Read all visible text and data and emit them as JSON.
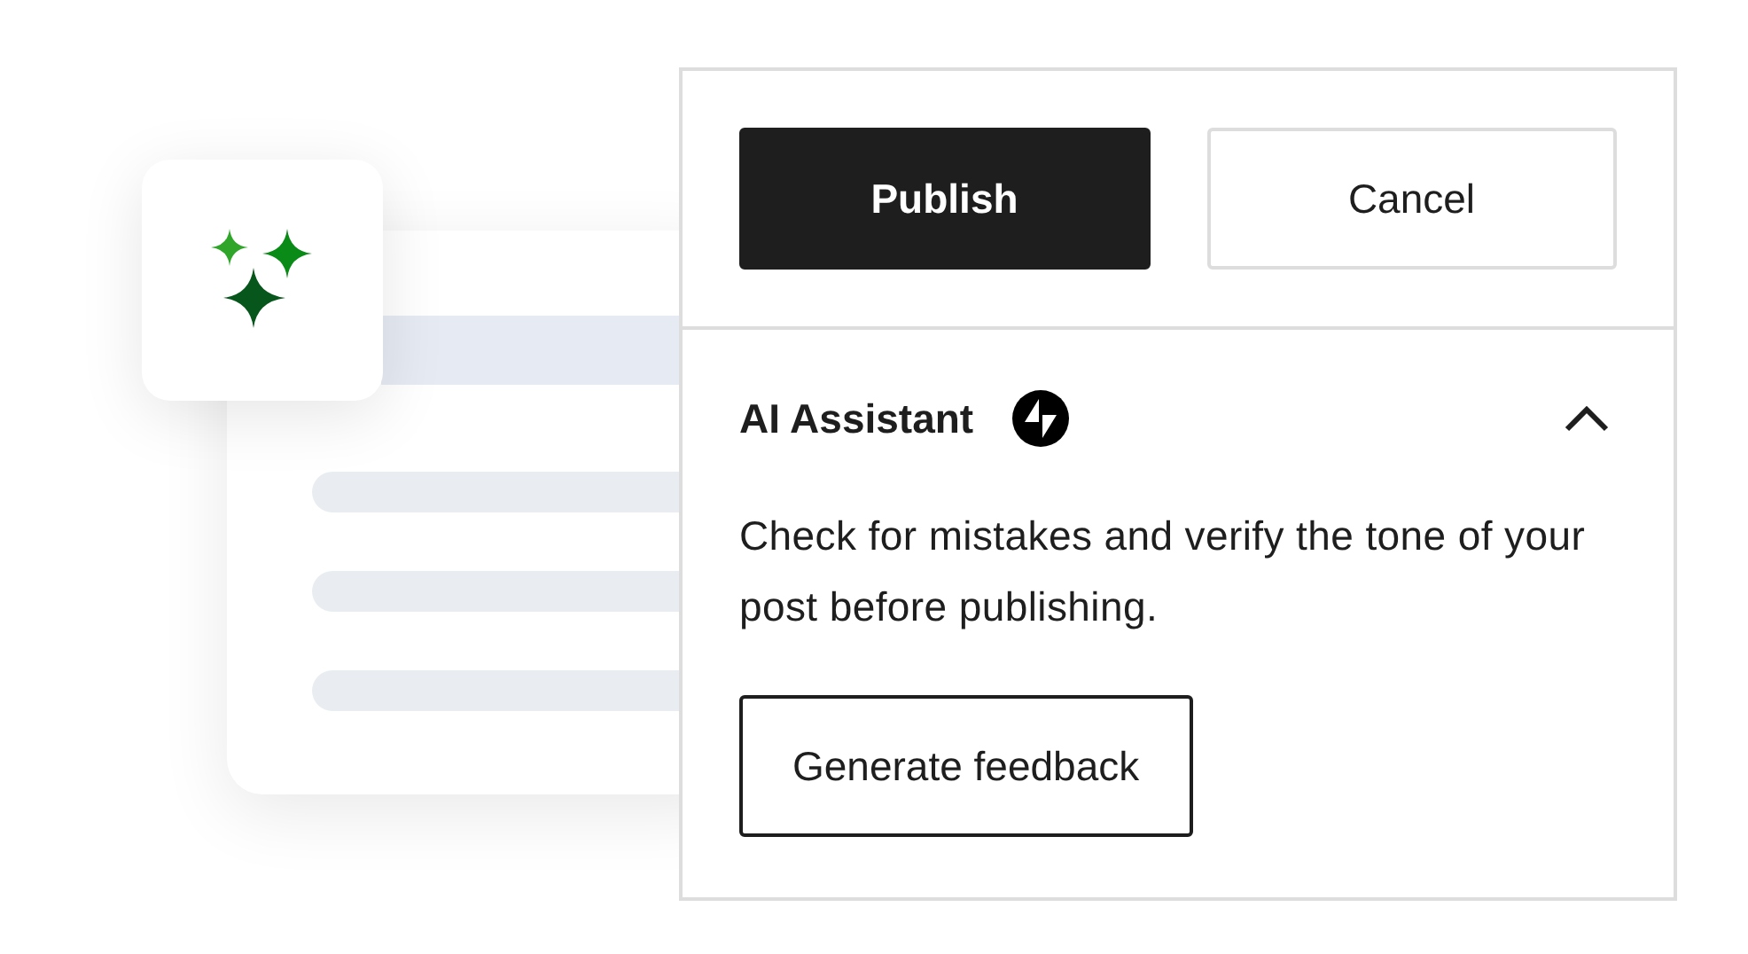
{
  "panel": {
    "buttons": [
      {
        "label": "Publish",
        "kind": "primary"
      },
      {
        "label": "Cancel",
        "kind": "secondary"
      }
    ],
    "section": {
      "title": "AI Assistant",
      "expanded": true,
      "description": "Check for mistakes and verify the tone of your post before publishing.",
      "action": "Generate feedback"
    }
  }
}
